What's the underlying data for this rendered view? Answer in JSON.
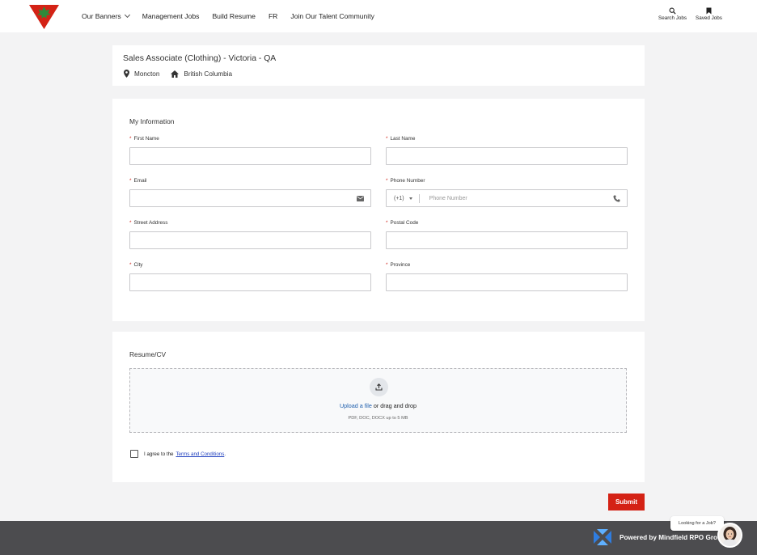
{
  "header": {
    "nav": [
      {
        "label": "Our Banners",
        "has_dropdown": true
      },
      {
        "label": "Management Jobs"
      },
      {
        "label": "Build Resume"
      },
      {
        "label": "FR"
      },
      {
        "label": "Join Our Talent Community"
      }
    ],
    "search_jobs": "Search Jobs",
    "saved_jobs": "Saved Jobs",
    "icons": {
      "logo": "canadian-tire-triangle-logo",
      "search": "search-icon",
      "saved": "bookmark-icon"
    }
  },
  "job": {
    "title": "Sales Associate (Clothing) - Victoria - QA",
    "city": "Moncton",
    "province": "British Columbia"
  },
  "my_information": {
    "title": "My Information",
    "required_marker": "*",
    "fields": {
      "first_name": {
        "label": "First Name",
        "value": ""
      },
      "last_name": {
        "label": "Last Name",
        "value": ""
      },
      "email": {
        "label": "Email",
        "value": ""
      },
      "phone": {
        "label": "Phone Number",
        "country_code": "(+1)",
        "placeholder": "Phone Number",
        "value": ""
      },
      "street": {
        "label": "Street Address",
        "value": ""
      },
      "postal": {
        "label": "Postal Code",
        "value": ""
      },
      "city": {
        "label": "City",
        "value": ""
      },
      "province": {
        "label": "Province",
        "value": ""
      }
    }
  },
  "resume": {
    "title": "Resume/CV",
    "upload_link": "Upload a file",
    "upload_rest": " or drag and drop",
    "hint": "PDF, DOC, DOCX up to 5 MB",
    "agree_prefix": "I agree to the",
    "terms_link": "Terms and Conditions",
    "agree_suffix": ".",
    "agreed": false
  },
  "submit_label": "Submit",
  "footer": {
    "powered_by": "Powered by Mindfield RPO Group Inc."
  },
  "chat": {
    "bubble": "Looking for a Job?"
  },
  "colors": {
    "brand_red": "#d42215",
    "link_blue": "#1f5fad",
    "footer_bg": "#4c4c4f",
    "page_bg": "#f3f3f4"
  }
}
